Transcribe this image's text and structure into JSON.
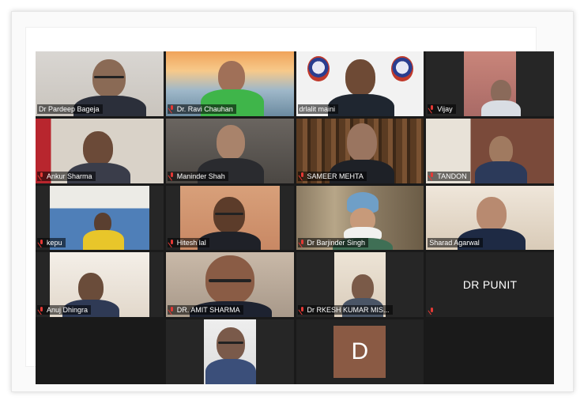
{
  "participants": [
    {
      "name": "Dr Pardeep Bageja",
      "muted": false
    },
    {
      "name": "Dr. Ravi Chauhan",
      "muted": true
    },
    {
      "name": "drlalit maini",
      "muted": false
    },
    {
      "name": "Vijay",
      "muted": true
    },
    {
      "name": "Ankur Sharma",
      "muted": true
    },
    {
      "name": "Maninder Shah",
      "muted": true
    },
    {
      "name": "SAMEER MEHTA",
      "muted": true
    },
    {
      "name": "TANDON",
      "muted": true
    },
    {
      "name": "kepu",
      "muted": true
    },
    {
      "name": "Hitesh lal",
      "muted": true
    },
    {
      "name": "Dr Barjinder Singh",
      "muted": true
    },
    {
      "name": "Sharad Agarwal",
      "muted": false
    },
    {
      "name": "Anuj Dhingra",
      "muted": true
    },
    {
      "name": "DR. AMIT SHARMA",
      "muted": true
    },
    {
      "name": "Dr RKESH KUMAR MIS...",
      "muted": true
    },
    {
      "name": "DR PUNIT",
      "muted": true,
      "video_off": true
    },
    {
      "name": "",
      "muted": false
    },
    {
      "name": "",
      "avatar_letter": "D"
    }
  ],
  "active_speaker_color": "#9ecb3a",
  "mute_icon_color": "#e53935"
}
